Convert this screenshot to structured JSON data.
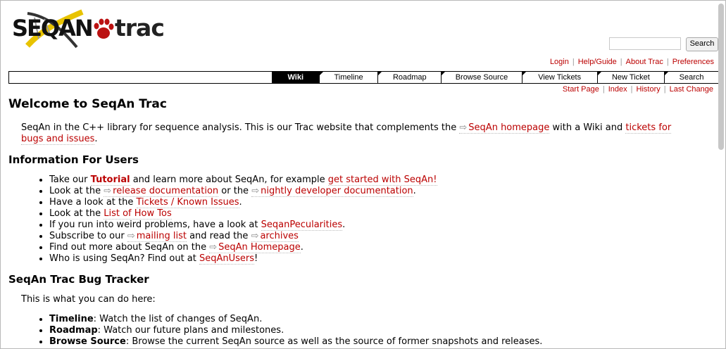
{
  "logo": {
    "text_seq": "SEQ",
    "text_an": "AN",
    "text_trac": "trac"
  },
  "search": {
    "placeholder": "",
    "button": "Search"
  },
  "metanav": [
    "Login",
    "Help/Guide",
    "About Trac",
    "Preferences"
  ],
  "mainnav": [
    "Wiki",
    "Timeline",
    "Roadmap",
    "Browse Source",
    "View Tickets",
    "New Ticket",
    "Search"
  ],
  "ctxtnav": [
    "Start Page",
    "Index",
    "History",
    "Last Change"
  ],
  "page": {
    "title": "Welcome to SeqAn Trac",
    "intro_1": "SeqAn in the C++ library for sequence analysis. This is our Trac website that complements the ",
    "intro_link1": "SeqAn homepage",
    "intro_2": " with a Wiki and ",
    "intro_link2a": "tickets for",
    "intro_link2b": "bugs and issues",
    "intro_3": ".",
    "users_heading": "Information For Users",
    "users": [
      {
        "pre": "Take our ",
        "link": "Tutorial",
        "mid": " and learn more about SeqAn, for example ",
        "link2": "get started with SeqAn!",
        "post": ""
      },
      {
        "pre": "Look at the ",
        "link": "release documentation",
        "mid": " or the ",
        "link2": "nightly developer documentation",
        "post": "."
      },
      {
        "pre": "Have a look at the ",
        "link": "Tickets / Known Issues",
        "post": "."
      },
      {
        "pre": "Look at the ",
        "link": "List of How Tos",
        "post": ""
      },
      {
        "pre": "If you run into weird problems, have a look at ",
        "link": "SeqanPecularities",
        "post": "."
      },
      {
        "pre": "Subscribe to our ",
        "link": "mailing list",
        "mid": " and read the ",
        "link2": "archives",
        "post": ""
      },
      {
        "pre": "Find out more about SeqAn on the ",
        "link": "SeqAn Homepage",
        "post": "."
      },
      {
        "pre": "Who is using SeqAn? Find out at ",
        "link": "SeqAnUsers",
        "post": "!"
      }
    ],
    "tracker_heading": "SeqAn Trac Bug Tracker",
    "tracker_intro": "This is what you can do here:",
    "tracker": [
      {
        "term": "Timeline",
        "desc": ": Watch the list of changes of SeqAn."
      },
      {
        "term": "Roadmap",
        "desc": ": Watch our future plans and milestones."
      },
      {
        "term": "Browse Source",
        "desc": ": Browse the current SeqAn source as well as the source of former snapshots and releases."
      }
    ]
  },
  "colors": {
    "link": "#bb0000",
    "active_tab": "#000000"
  }
}
